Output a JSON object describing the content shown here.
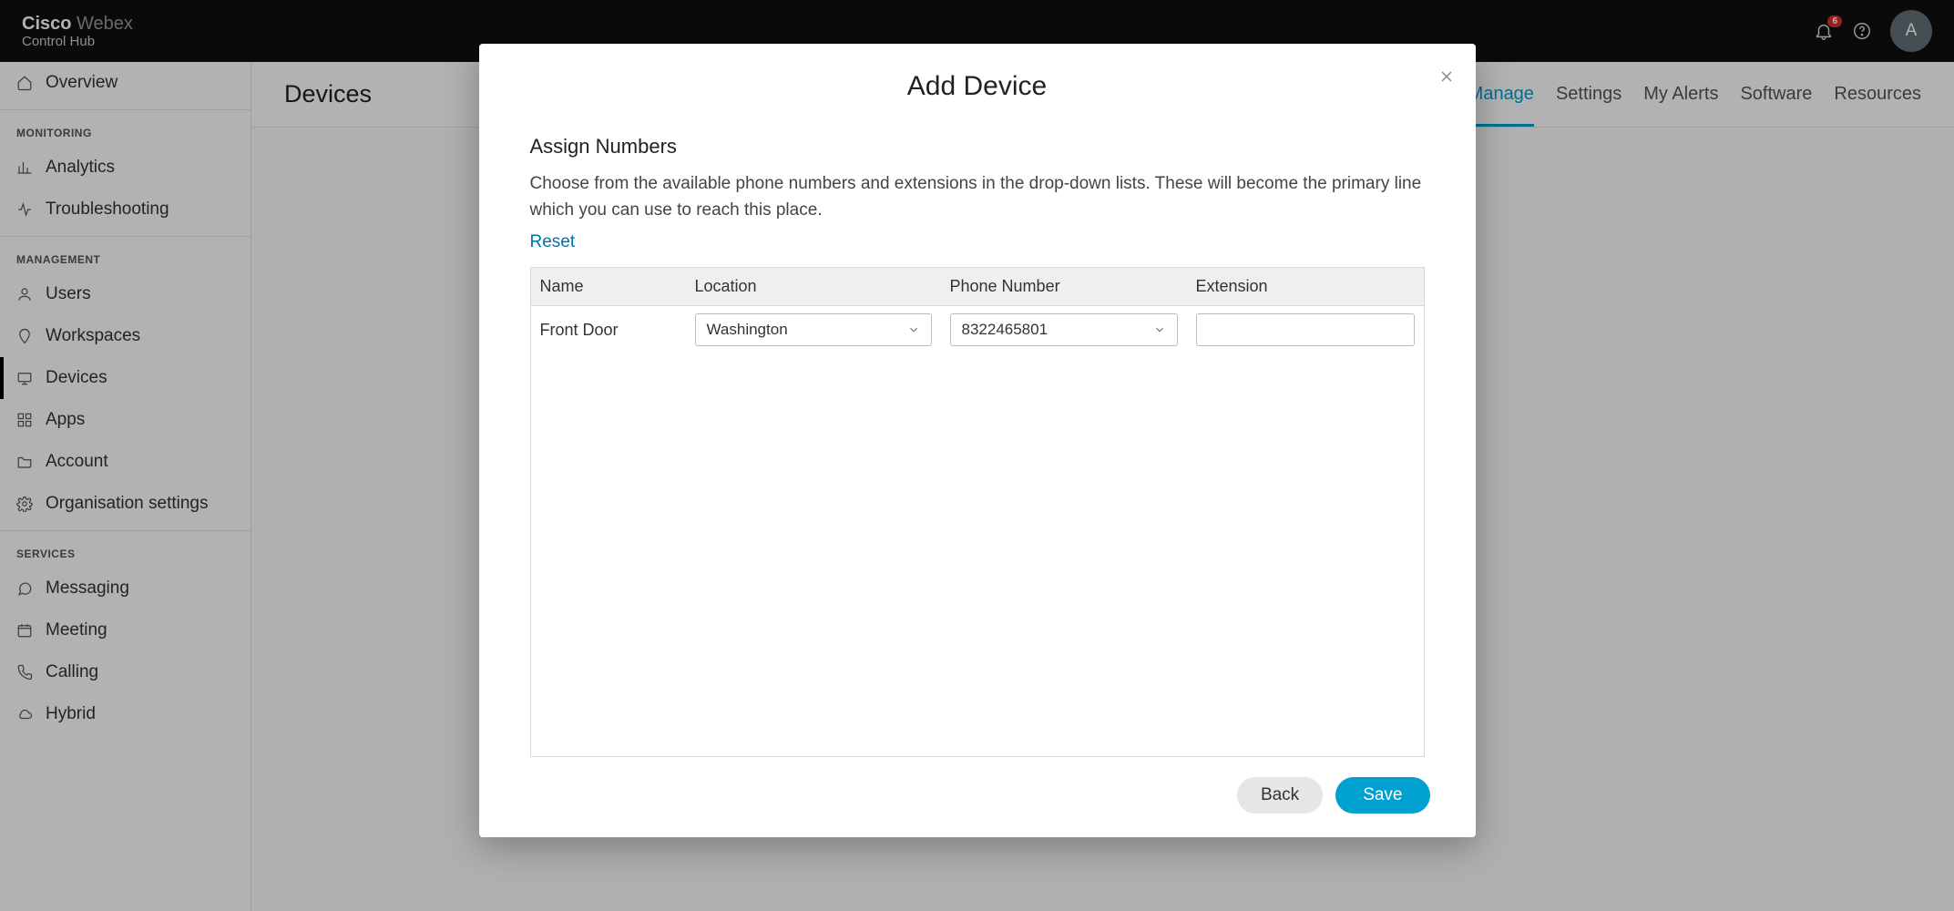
{
  "brand": {
    "prefix": "Cisco",
    "product": "Webex",
    "sub": "Control Hub"
  },
  "header": {
    "notif_count": "6",
    "avatar_initial": "A"
  },
  "sidebar": {
    "overview": "Overview",
    "sections": {
      "monitoring": "MONITORING",
      "management": "MANAGEMENT",
      "services": "SERVICES"
    },
    "items": {
      "analytics": "Analytics",
      "troubleshooting": "Troubleshooting",
      "users": "Users",
      "workspaces": "Workspaces",
      "devices": "Devices",
      "apps": "Apps",
      "account": "Account",
      "org_settings": "Organisation settings",
      "messaging": "Messaging",
      "meeting": "Meeting",
      "calling": "Calling",
      "hybrid": "Hybrid"
    }
  },
  "main": {
    "title": "Devices",
    "tabs": {
      "manage": "Manage",
      "settings": "Settings",
      "my_alerts": "My Alerts",
      "software": "Software",
      "resources": "Resources"
    }
  },
  "modal": {
    "title": "Add Device",
    "section_title": "Assign Numbers",
    "section_desc": "Choose from the available phone numbers and extensions in the drop-down  lists. These will become the primary line which you can use  to reach this place.",
    "reset": "Reset",
    "columns": {
      "name": "Name",
      "location": "Location",
      "phone": "Phone Number",
      "extension": "Extension"
    },
    "row": {
      "name": "Front Door",
      "location_value": "Washington",
      "phone_value": "8322465801",
      "extension_value": ""
    },
    "buttons": {
      "back": "Back",
      "save": "Save"
    }
  }
}
